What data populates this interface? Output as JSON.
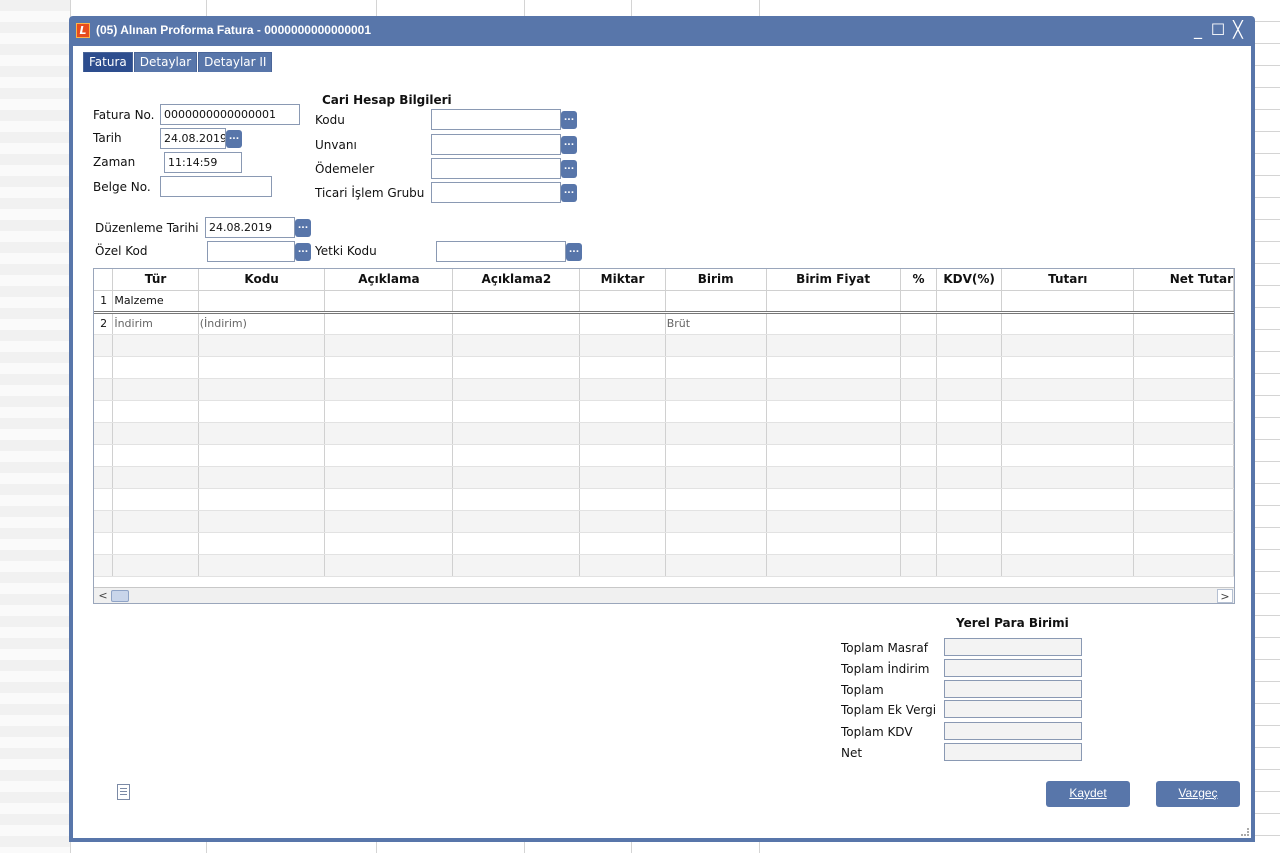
{
  "window": {
    "title": "(05) Alınan Proforma Fatura - 0000000000000001",
    "app_icon_glyph": "L",
    "minimize": "_",
    "maximize": "☐",
    "close": "╳"
  },
  "tabs": [
    {
      "label": "Fatura",
      "active": true
    },
    {
      "label": "Detaylar",
      "active": false
    },
    {
      "label": "Detaylar II",
      "active": false
    }
  ],
  "header": {
    "fatura_no_label": "Fatura No.",
    "fatura_no_value": "0000000000000001",
    "tarih_label": "Tarih",
    "tarih_value": "24.08.2019",
    "zaman_label": "Zaman",
    "zaman_value": "11:14:59",
    "belge_no_label": "Belge No.",
    "belge_no_value": "",
    "duzenleme_tarihi_label": "Düzenleme Tarihi",
    "duzenleme_tarihi_value": "24.08.2019",
    "ozel_kod_label": "Özel Kod",
    "ozel_kod_value": "",
    "yetki_kodu_label": "Yetki Kodu",
    "yetki_kodu_value": ""
  },
  "cari": {
    "title": "Cari Hesap Bilgileri",
    "kodu_label": "Kodu",
    "unvani_label": "Unvanı",
    "odemeler_label": "Ödemeler",
    "ticari_label": "Ticari İşlem Grubu"
  },
  "dots_button": "...",
  "grid": {
    "columns": [
      "",
      "Tür",
      "Kodu",
      "Açıklama",
      "Açıklama2",
      "Miktar",
      "Birim",
      "Birim Fiyat",
      "%",
      "KDV(%)",
      "Tutarı",
      "Net Tutar"
    ],
    "rows": [
      [
        "1",
        "Malzeme",
        "",
        "",
        "",
        "",
        "",
        "",
        "",
        "",
        "",
        ""
      ],
      [
        "2",
        "İndirim",
        "(İndirim)",
        "",
        "",
        "",
        "Brüt",
        "",
        "",
        "",
        "",
        ""
      ]
    ],
    "scroll_left": "<",
    "scroll_right": ">"
  },
  "totals": {
    "title": "Yerel Para Birimi",
    "labels": [
      "Toplam Masraf",
      "Toplam İndirim",
      "Toplam",
      "Toplam Ek Vergi",
      "Toplam KDV",
      "Net"
    ]
  },
  "buttons": {
    "save": "Kaydet",
    "cancel": "Vazgeç"
  },
  "colors": {
    "window_frame": "#5876aa",
    "active_tab": "#2d4d8e"
  }
}
